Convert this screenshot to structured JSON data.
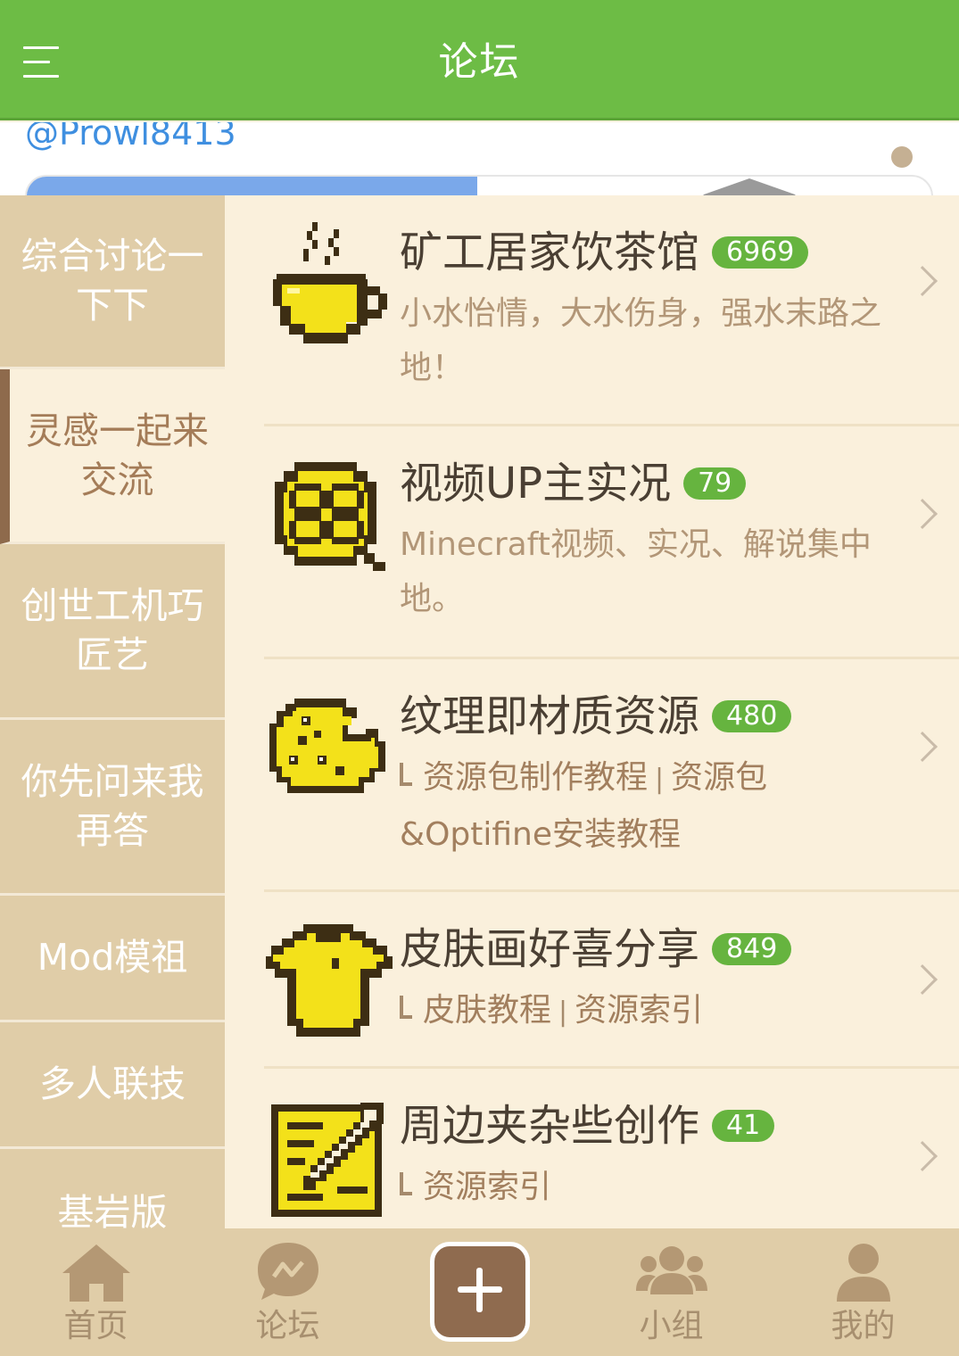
{
  "topbar": {
    "title": "论坛",
    "menu_icon": "menu-icon"
  },
  "banner": {
    "mention": "@Prowl8413"
  },
  "sidebar": {
    "items": [
      {
        "label": "综合讨论一下下",
        "active": false
      },
      {
        "label": "灵感一起来交流",
        "active": true
      },
      {
        "label": "创世工机巧匠艺",
        "active": false
      },
      {
        "label": "你先问来我再答",
        "active": false
      },
      {
        "label": "Mod模祖",
        "active": false
      },
      {
        "label": "多人联技",
        "active": false
      },
      {
        "label": "基岩版",
        "active": false
      }
    ]
  },
  "forums": [
    {
      "name": "矿工居家饮茶馆",
      "count": "6969",
      "icon": "teacup-icon",
      "description": "小水怡情，大水伤身，强水末路之地！"
    },
    {
      "name": "视频UP主实况",
      "count": "79",
      "icon": "film-reel-icon",
      "description": "Minecraft视频、实况、解说集中地。"
    },
    {
      "name": "纹理即材质资源",
      "count": "480",
      "icon": "cookie-icon",
      "links": [
        "资源包制作教程",
        "资源包&Optifine安装教程"
      ]
    },
    {
      "name": "皮肤画好喜分享",
      "count": "849",
      "icon": "tshirt-icon",
      "links": [
        "皮肤教程",
        "资源索引"
      ]
    },
    {
      "name": "周边夹杂些创作",
      "count": "41",
      "icon": "pencil-note-icon",
      "links": [
        "资源索引"
      ]
    }
  ],
  "link_separator": "|",
  "bottomnav": {
    "home": "首页",
    "forum": "论坛",
    "groups": "小组",
    "mine": "我的",
    "compose_icon": "plus-icon"
  },
  "colors": {
    "topbar": "#6dbc45",
    "badge": "#66b43f",
    "sidebar": "#e0cda8",
    "background": "#faf0dc",
    "accent_brown": "#8f6b4f",
    "icon_yellow": "#f5e21a"
  }
}
